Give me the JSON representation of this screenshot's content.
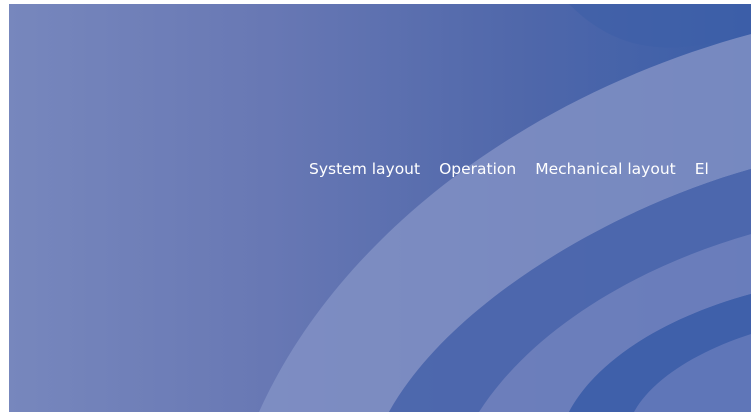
{
  "nav": {
    "items": [
      {
        "label": "System layout"
      },
      {
        "label": "Operation"
      },
      {
        "label": "Mechanical layout"
      },
      {
        "label": "El"
      }
    ]
  },
  "colors": {
    "background_left": "#7787bd",
    "background_right": "#3a5ea8",
    "arc_light": "#8d9bc8",
    "arc_dark": "#3d63ad",
    "text": "#ffffff"
  }
}
